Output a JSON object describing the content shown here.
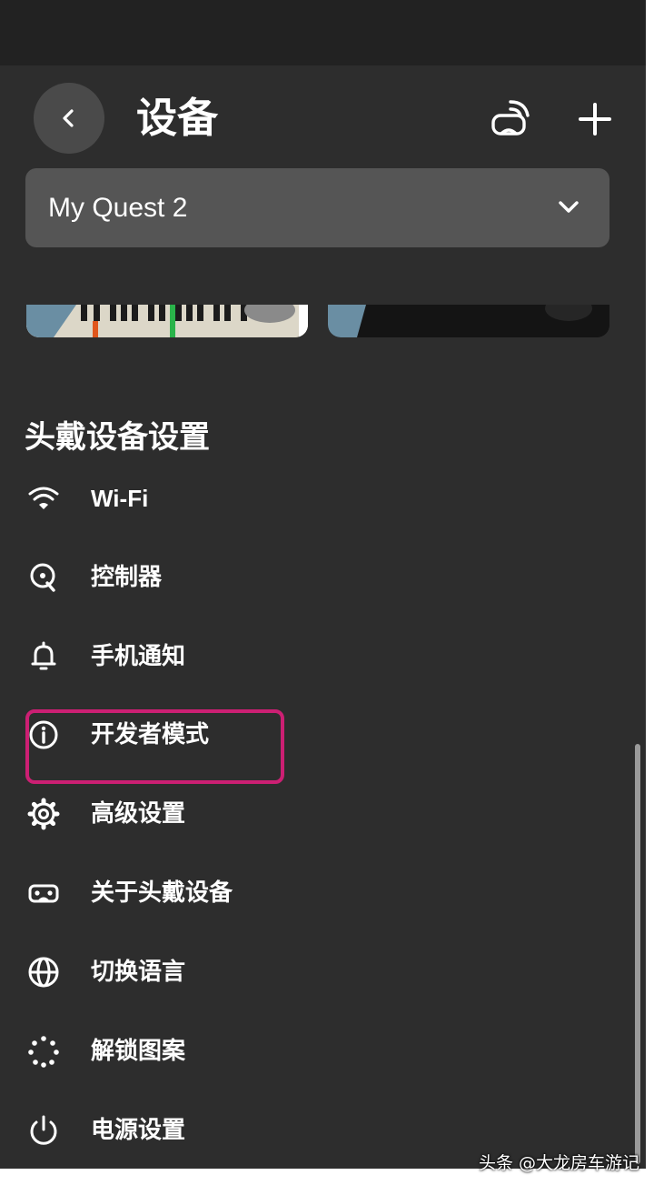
{
  "header": {
    "title": "设备",
    "back_icon": "chevron-left-icon",
    "cast_icon": "cast-headset-icon",
    "add_icon": "plus-icon"
  },
  "device_selector": {
    "value": "My Quest 2",
    "icon": "chevron-down-icon"
  },
  "section_title": "头戴设备设置",
  "menu": [
    {
      "label": "Wi-Fi",
      "icon": "wifi-icon"
    },
    {
      "label": "控制器",
      "icon": "controller-icon"
    },
    {
      "label": "手机通知",
      "icon": "bell-icon"
    },
    {
      "label": "开发者模式",
      "icon": "info-icon"
    },
    {
      "label": "高级设置",
      "icon": "gear-icon"
    },
    {
      "label": "关于头戴设备",
      "icon": "headset-icon"
    },
    {
      "label": "切换语言",
      "icon": "globe-icon"
    },
    {
      "label": "解锁图案",
      "icon": "pattern-dots-icon"
    },
    {
      "label": "电源设置",
      "icon": "power-icon"
    }
  ],
  "colors": {
    "background": "#2d2d2d",
    "highlight": "#cc1f73",
    "select_bg": "#555555"
  },
  "watermark": "头条 @大龙房车游记"
}
